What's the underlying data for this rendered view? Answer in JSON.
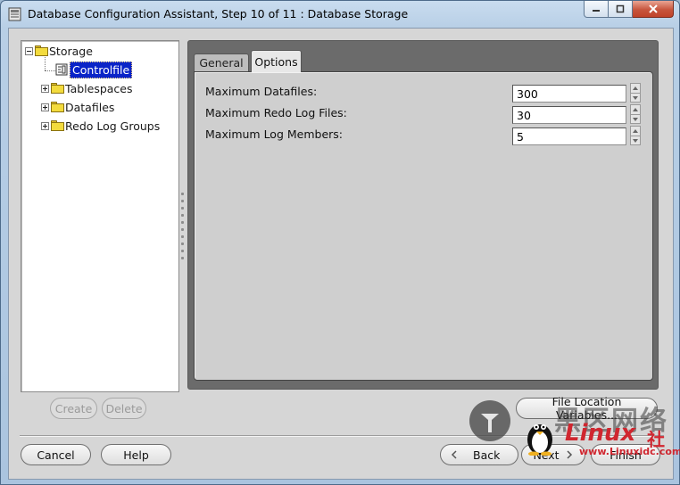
{
  "window": {
    "title": "Database Configuration Assistant, Step 10 of 11 : Database Storage"
  },
  "tree": {
    "root_label": "Storage",
    "items": [
      {
        "label": "Controlfile",
        "selected": true
      },
      {
        "label": "Tablespaces"
      },
      {
        "label": "Datafiles"
      },
      {
        "label": "Redo Log Groups"
      }
    ]
  },
  "tabs": {
    "general": "General",
    "options": "Options",
    "active": "Options"
  },
  "options": {
    "max_datafiles_label": "Maximum Datafiles:",
    "max_datafiles_value": "300",
    "max_redo_label": "Maximum Redo Log Files:",
    "max_redo_value": "30",
    "max_members_label": "Maximum Log Members:",
    "max_members_value": "5"
  },
  "buttons": {
    "create": "Create",
    "delete": "Delete",
    "file_location": "File Location Variables...",
    "cancel": "Cancel",
    "help": "Help",
    "back": "Back",
    "next": "Next",
    "finish": "Finish"
  },
  "watermark": {
    "big_text": "黑区网络",
    "brand": "Linux",
    "brand_suffix": "社",
    "site": "www.Linuxidc.com"
  },
  "colors": {
    "selection": "#0a24c8",
    "client_bg": "#d6d6d6",
    "panel_dark": "#6b6b6b",
    "watermark_red": "#d0262f"
  }
}
